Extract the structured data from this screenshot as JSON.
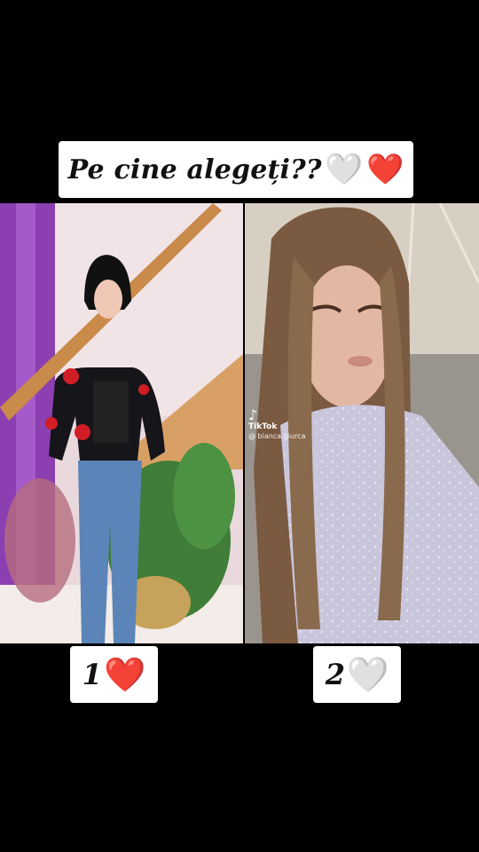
{
  "title": {
    "text": "Pe cine alegeți??",
    "emoji_white_heart": "🤍",
    "emoji_red_heart": "❤️"
  },
  "options": [
    {
      "number": "1",
      "heart": "❤️",
      "heart_icon": "red-heart-icon"
    },
    {
      "number": "2",
      "heart": "🤍",
      "heart_icon": "white-heart-icon"
    }
  ],
  "watermark": {
    "brand": "TikTok",
    "username": "@ bianca.giurca"
  },
  "colors": {
    "background": "#000000",
    "card": "#ffffff",
    "red_heart": "#e0171e",
    "white_heart": "#e6e6e6"
  }
}
